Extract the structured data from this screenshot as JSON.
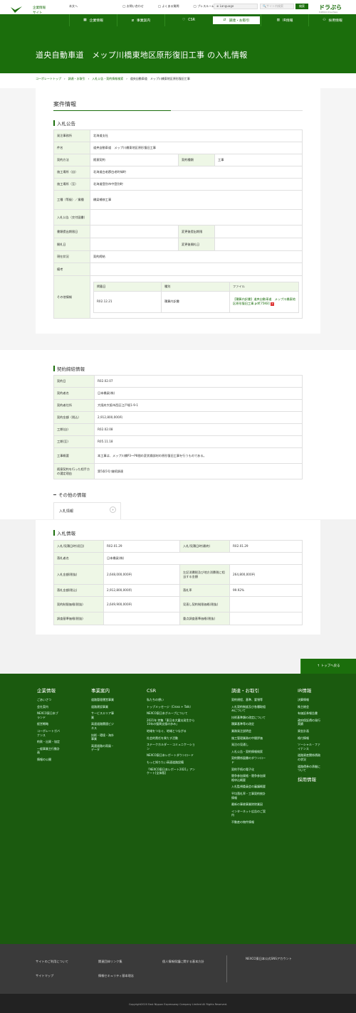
{
  "header": {
    "company_line1": "企業情報",
    "company_line2": "サイト",
    "logo_text": "NEXCO 東日本",
    "home": "本文へ",
    "links": [
      "お問い合わせ",
      "よくある質問",
      "プレスルーム"
    ],
    "language": "Language",
    "search_placeholder": "サイト内検索",
    "search_btn": "検索",
    "dora_title": "ドラぷら",
    "dora_sub": "E-NEXCO Drive Plaza"
  },
  "nav": [
    "企業情報",
    "事業案内",
    "CSR",
    "調達・お取引",
    "IR情報",
    "採用情報"
  ],
  "hero_title": "道央自動車道　メップ川橋東地区原形復旧工事 の入札情報",
  "breadcrumb": [
    "コーポレートトップ",
    "調達・お取引",
    "入札公告・契約情報検索",
    "道央自動車道　メップ川橋東地区原形復旧工事"
  ],
  "section_title": "案件情報",
  "bid_notice": {
    "heading": "入札公告",
    "rows": [
      [
        "発注事務所",
        "北海道支社"
      ],
      [
        "件名",
        "道央自動車道　メップ川橋東地区原形復旧工事"
      ]
    ],
    "method_label": "契約方法",
    "method": "随意契約",
    "kind_label": "契約種類",
    "kind": "工事",
    "place_from_label": "施工場所（自）",
    "place_from": "北海道白老郡白老町緑町",
    "place_to_label": "施工場所（至）",
    "place_to": "北海道登別市中登別町",
    "type_label": "工種（等級）／業種",
    "type": "橋梁補修工事",
    "notice_label": "入札公告（交付図書）",
    "notice": "",
    "deadline_label": "書類提出期限日",
    "deadline": "",
    "deadline_ch_label": "変更後提出期限",
    "deadline_ch": "",
    "open_label": "開札日",
    "open": "",
    "open_ch_label": "変更後開札日",
    "open_ch": "",
    "status_label": "現在状況",
    "status": "契約締結",
    "remarks_label": "備考",
    "remarks": "",
    "other_label": "その他情報",
    "other_headers": [
      "掲載日",
      "種別",
      "ファイル"
    ],
    "other_row": {
      "date": "R02.12.21",
      "kind": "積算内訳書",
      "file": "【積算内訳書】道央自動車道　メップ川橋東地区原形復旧工事.pdf[75KB]"
    }
  },
  "contract": {
    "heading": "契約締結情報",
    "rows": [
      [
        "契約日",
        "R02.02.07"
      ],
      [
        "契約者名",
        "日本橋梁(株)"
      ],
      [
        "契約者住所",
        "大阪府大阪市西区江戸堀1-9-1"
      ],
      [
        "契約金額（税込）",
        "2,912,800,000円"
      ],
      [
        "工期(自)",
        "R02.02.08"
      ],
      [
        "工期(至)",
        "R05.11.18"
      ],
      [
        "工事概要",
        "本工事は、メップ川橋P3～P8間の変状鋼部材の原形復旧工事を行うものである。"
      ],
      [
        "随意契約を行った相手方の選定理由",
        "第5条5号:継続調達"
      ]
    ]
  },
  "other_info": {
    "heading": "その他の情報",
    "tab": "入札情報",
    "tab_icon": "+"
  },
  "bid_info": {
    "heading": "入札情報",
    "r1": [
      "入札/見積日時(初回)",
      "R02.01.29",
      "入札/見積日時(最終)",
      "R02.01.29"
    ],
    "r2": [
      "落札者名",
      "日本橋梁(株)"
    ],
    "r3": [
      "入札金額(税抜)",
      "2,648,000,000円",
      "左記消費税及び地方消費税に相当する金額",
      "264,800,000円"
    ],
    "r4": [
      "落札金額(税込)",
      "2,912,800,000円",
      "落札率",
      "99.92%"
    ],
    "r5": [
      "契約制限価格(税抜)",
      "2,649,900,000円",
      "見直し契約制限価格(税抜)",
      ""
    ],
    "r6": [
      "調査基準価格(税抜)",
      "",
      "重点調査基準価格(税抜)",
      ""
    ]
  },
  "to_top": "トップへ戻る",
  "footer": {
    "col1": {
      "title": "企業情報",
      "items": [
        "ごあいさつ",
        "会社案内",
        "NEXCO東日本ブランド",
        "経営戦略",
        "コーポレートガバナンス",
        "約款・出資・協定",
        "一般事業主行動計画",
        "情報の公開"
      ]
    },
    "col2": {
      "title": "事業案内",
      "items": [
        "道路管理運営事業",
        "道路建設事業",
        "サービスエリア事業",
        "高速道路関連ビジネス",
        "技術・環境・海外事業",
        "高速道路の雨風・データ"
      ]
    },
    "col3": {
      "title": "CSR",
      "items": [
        "私たちの想い",
        "トップメッセージ（Cross + Talk）",
        "NEXCO東日本グループについて",
        "2021年 特集「東日本大震災発生から10年の復興支援の歩み」",
        "地域をつなぐ、地域とつながる",
        "社会的責任を果たす活動",
        "ステークホルダー・コミュニケーション",
        "NEXCO東日本レポートダウンロード",
        "もっと知りたい高速道路設備",
        "「NEXCO東日本レポート2021」アンケート[全体版]"
      ]
    },
    "col4": {
      "title": "調達・お取引",
      "items": [
        "契約規程、基準、要領等",
        "入札契約制度及び各種取組みについて",
        "技術基準類の改定について",
        "積算基準等の改定",
        "業務発注説明会",
        "施工管理業務の中間評価",
        "発注の見通し",
        "入札公告・契約情報検索",
        "契約関係図書のダウンロード",
        "契約手続の電子化",
        "競争参加資格・競争参加資格申込概要",
        "入札監視委員会の審議概要",
        "平均落札率・工事契約統計情報",
        "最新の事故事業除除業因",
        "インターネット広告のご案内",
        "不動産の物件情報"
      ]
    },
    "col5": {
      "title": "IR情報",
      "items": [
        "決算情報",
        "株主総会",
        "有価証券報告書",
        "政府保証債の発行実績",
        "資金計画",
        "格付情報",
        "ソーシャル・ファイナンス",
        "道路資産関係債務の状況",
        "道路債券の承継について"
      ]
    },
    "col5b": {
      "title": "採用情報"
    },
    "bottom": [
      "サイトのご利用について",
      "関連団体リンク集",
      "個人情報保護に関する基本方針",
      "サイトマップ",
      "情報セキュリティ基本理念"
    ],
    "sns": "NEXCO東日本公式SNSアカウント",
    "copyright": "Copyright2020 East Nippon Expressway Company Limited All Rights Reserved."
  }
}
